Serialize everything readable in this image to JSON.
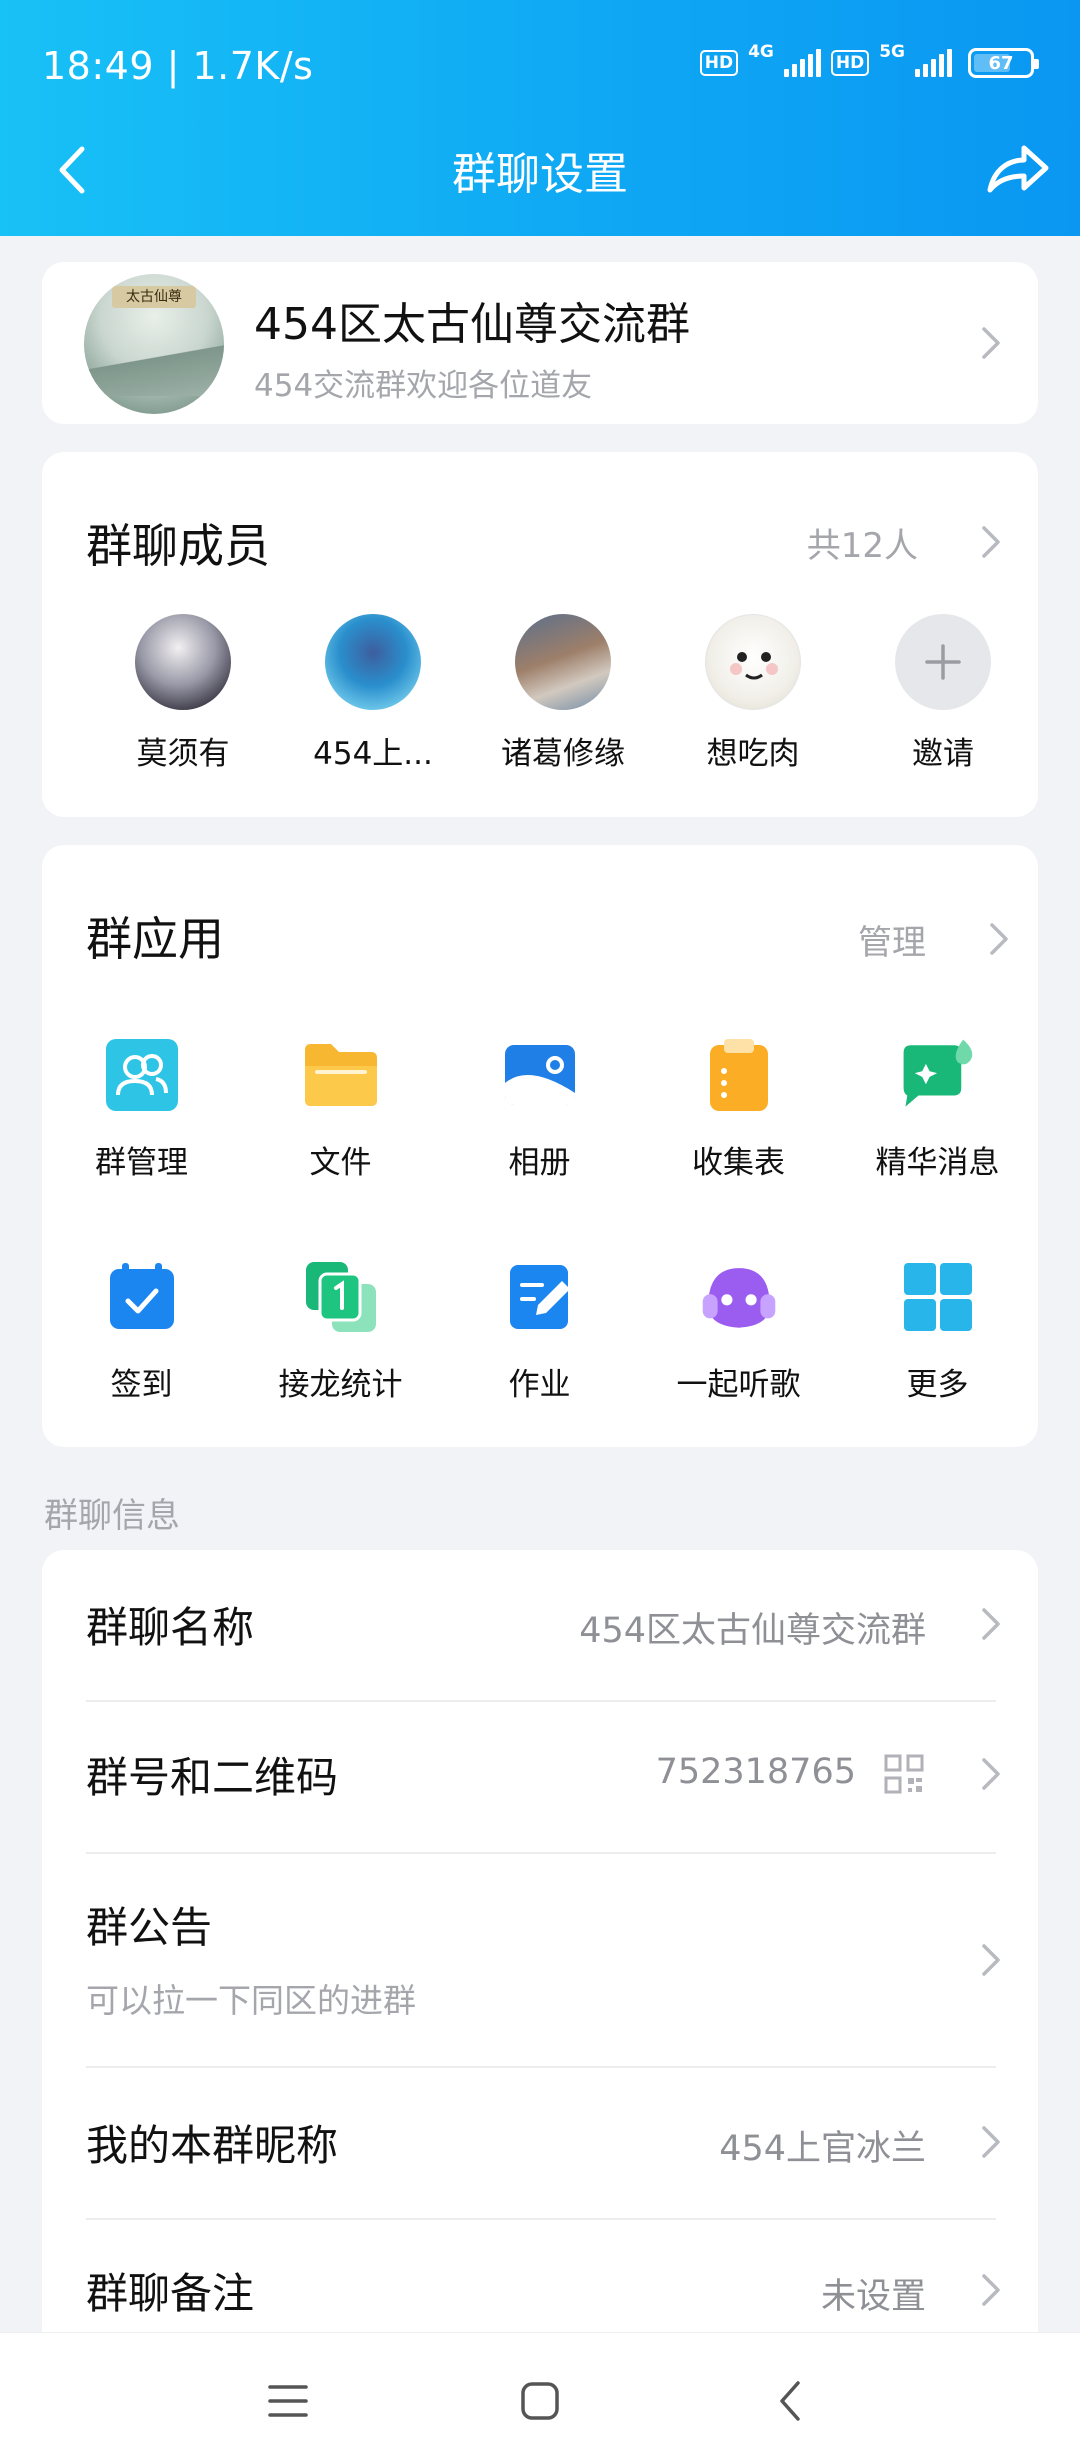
{
  "status_bar": {
    "time_speed": "18:49 | 1.7K/s",
    "sim1_hd": "HD",
    "sim1_net": "4G",
    "sim2_hd": "HD",
    "sim2_net": "5G",
    "battery": "67",
    "battery_fraction": 0.67
  },
  "header": {
    "title": "群聊设置",
    "back_icon": "back-arrow-icon",
    "share_icon": "share-icon",
    "background_color": "#0fa8f4"
  },
  "group": {
    "name": "454区太古仙尊交流群",
    "description": "454交流群欢迎各位道友",
    "avatar_text": "太古仙尊"
  },
  "members": {
    "title": "群聊成员",
    "count_label": "共12人",
    "list": [
      {
        "name": "莫须有"
      },
      {
        "name": "454上..."
      },
      {
        "name": "诸葛修缘"
      },
      {
        "name": "想吃肉"
      },
      {
        "name": "邀请"
      }
    ]
  },
  "apps": {
    "title": "群应用",
    "manage_label": "管理",
    "items": [
      {
        "label": "群管理",
        "icon": "group-manage-icon"
      },
      {
        "label": "文件",
        "icon": "folder-icon"
      },
      {
        "label": "相册",
        "icon": "album-icon"
      },
      {
        "label": "收集表",
        "icon": "clipboard-icon"
      },
      {
        "label": "精华消息",
        "icon": "featured-message-icon"
      },
      {
        "label": "签到",
        "icon": "calendar-check-icon"
      },
      {
        "label": "接龙统计",
        "icon": "relay-count-icon"
      },
      {
        "label": "作业",
        "icon": "homework-icon"
      },
      {
        "label": "一起听歌",
        "icon": "listen-music-icon"
      },
      {
        "label": "更多",
        "icon": "more-grid-icon"
      }
    ]
  },
  "info": {
    "heading": "群聊信息",
    "group_name_label": "群聊名称",
    "group_name_value": "454区太古仙尊交流群",
    "group_number_label": "群号和二维码",
    "group_number_value": "752318765",
    "notice_label": "群公告",
    "notice_value": "可以拉一下同区的进群",
    "nickname_label": "我的本群昵称",
    "nickname_value": "454上官冰兰",
    "remark_label": "群聊备注",
    "remark_value": "未设置"
  }
}
